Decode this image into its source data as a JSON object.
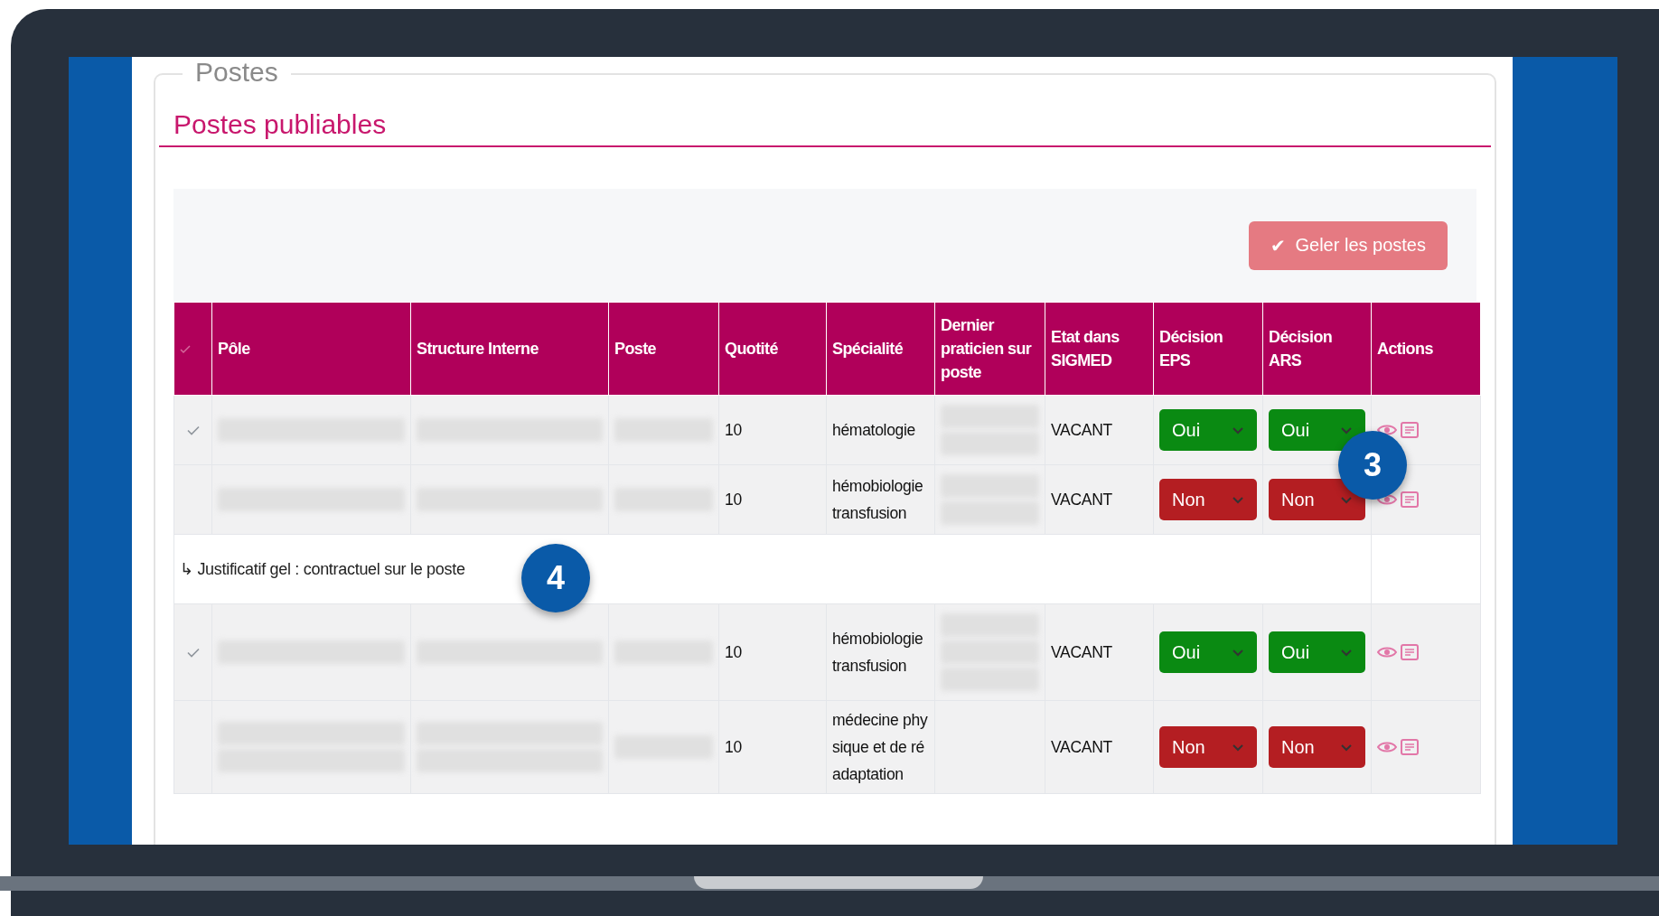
{
  "fieldset": {
    "legend": "Postes"
  },
  "section_title": "Postes publiables",
  "toolbar": {
    "button": {
      "icon": "✔",
      "label": "Geler les postes"
    }
  },
  "table": {
    "columns": [
      "Pôle",
      "Structure Interne",
      "Poste",
      "Quotité",
      "Spécialité",
      "Dernier praticien sur poste",
      "Etat dans SIGMED",
      "Décision EPS",
      "Décision ARS",
      "Actions"
    ],
    "rows": [
      {
        "kind": "post",
        "checked": true,
        "quotite": "10",
        "specialite": "hématologie",
        "etat": "VACANT",
        "decision_eps": {
          "value": "Oui",
          "color": "#0a8a12"
        },
        "decision_ars": {
          "value": "Oui",
          "color": "#0a8a12"
        }
      },
      {
        "kind": "post",
        "checked": false,
        "quotite": "10",
        "specialite": "hémobiologie transfusion",
        "etat": "VACANT",
        "decision_eps": {
          "value": "Non",
          "color": "#b41e22"
        },
        "decision_ars": {
          "value": "Non",
          "color": "#b41e22"
        }
      },
      {
        "kind": "note",
        "arrow": "↳",
        "text": "Justificatif gel : contractuel sur le poste"
      },
      {
        "kind": "post",
        "checked": true,
        "quotite": "10",
        "specialite": "hémobiologie transfusion",
        "etat": "VACANT",
        "decision_eps": {
          "value": "Oui",
          "color": "#0a8a12"
        },
        "decision_ars": {
          "value": "Oui",
          "color": "#0a8a12"
        }
      },
      {
        "kind": "post",
        "checked": false,
        "quotite": "10",
        "specialite": "médecine physique et de réadaptation",
        "etat": "VACANT",
        "decision_eps": {
          "value": "Non",
          "color": "#b41e22"
        },
        "decision_ars": {
          "value": "Non",
          "color": "#b41e22"
        }
      }
    ]
  },
  "callouts": [
    {
      "number": "3"
    },
    {
      "number": "4"
    }
  ]
}
